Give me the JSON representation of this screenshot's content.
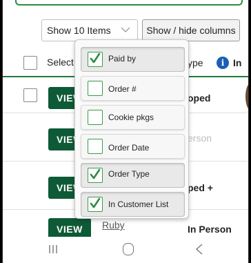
{
  "toolbar": {
    "items_select": "Show 10 Items",
    "columns_button": "Show / hide columns"
  },
  "table": {
    "header_select": "Select",
    "header_type": "ype",
    "header_in": "In"
  },
  "rows": [
    {
      "view": "VIEW",
      "type": "oped"
    },
    {
      "view": "VIEW",
      "type": "erson"
    },
    {
      "view": "VIEW",
      "type": "ped +"
    },
    {
      "view": "VIEW",
      "name": "Ruby",
      "type": "In Person"
    }
  ],
  "menu": {
    "options": [
      {
        "label": "Paid by",
        "checked": true
      },
      {
        "label": "Order #",
        "checked": false
      },
      {
        "label": "Cookie pkgs",
        "checked": false
      },
      {
        "label": "Order Date",
        "checked": false
      },
      {
        "label": "Order Type",
        "checked": true
      },
      {
        "label": "In Customer List",
        "checked": true
      }
    ]
  },
  "colors": {
    "accent_green": "#0f5a36",
    "check_green": "#3a9a4a",
    "info_blue": "#1a5fb4"
  },
  "icons": {
    "dropdown": "chevron-down-icon",
    "info": "info-icon",
    "check": "checkmark-icon",
    "recents": "recents-icon",
    "home": "home-icon",
    "back": "back-icon"
  }
}
